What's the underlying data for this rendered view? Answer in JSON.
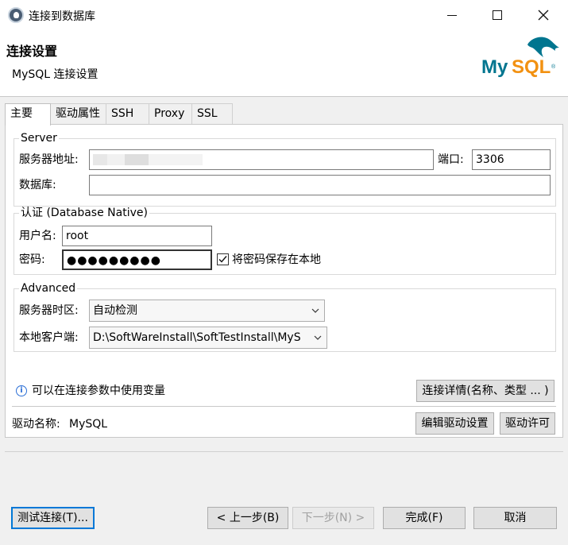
{
  "window": {
    "title": "连接到数据库"
  },
  "header": {
    "title": "连接设置",
    "subtitle": "MySQL 连接设置",
    "logo_text": "MySQL"
  },
  "tabs": [
    {
      "label": "主要",
      "active": true
    },
    {
      "label": "驱动属性"
    },
    {
      "label": "SSH"
    },
    {
      "label": "Proxy"
    },
    {
      "label": "SSL"
    }
  ],
  "server": {
    "legend": "Server",
    "host_label": "服务器地址:",
    "host_value": "",
    "port_label": "端口:",
    "port_value": "3306",
    "database_label": "数据库:",
    "database_value": ""
  },
  "auth": {
    "legend": "认证 (Database Native)",
    "user_label": "用户名:",
    "user_value": "root",
    "password_label": "密码:",
    "password_mask": "●●●●●●●●●",
    "save_password_label": "将密码保存在本地",
    "save_password_checked": true
  },
  "advanced": {
    "legend": "Advanced",
    "timezone_label": "服务器时区:",
    "timezone_value": "自动检测",
    "client_label": "本地客户端:",
    "client_value": "D:\\SoftWareInstall\\SoftTestInstall\\MyS"
  },
  "info": {
    "text": "可以在连接参数中使用变量",
    "details_button": "连接详情(名称、类型 ... )"
  },
  "driver": {
    "name_label": "驱动名称:",
    "name_value": "MySQL",
    "edit_button": "编辑驱动设置",
    "license_button": "驱动许可"
  },
  "footer": {
    "test_button": "测试连接(T)...",
    "back_button": "< 上一步(B)",
    "next_button": "下一步(N) >",
    "finish_button": "完成(F)",
    "cancel_button": "取消"
  },
  "colors": {
    "accent": "#0078d7",
    "logo_teal": "#00758f",
    "logo_orange": "#f29111"
  }
}
